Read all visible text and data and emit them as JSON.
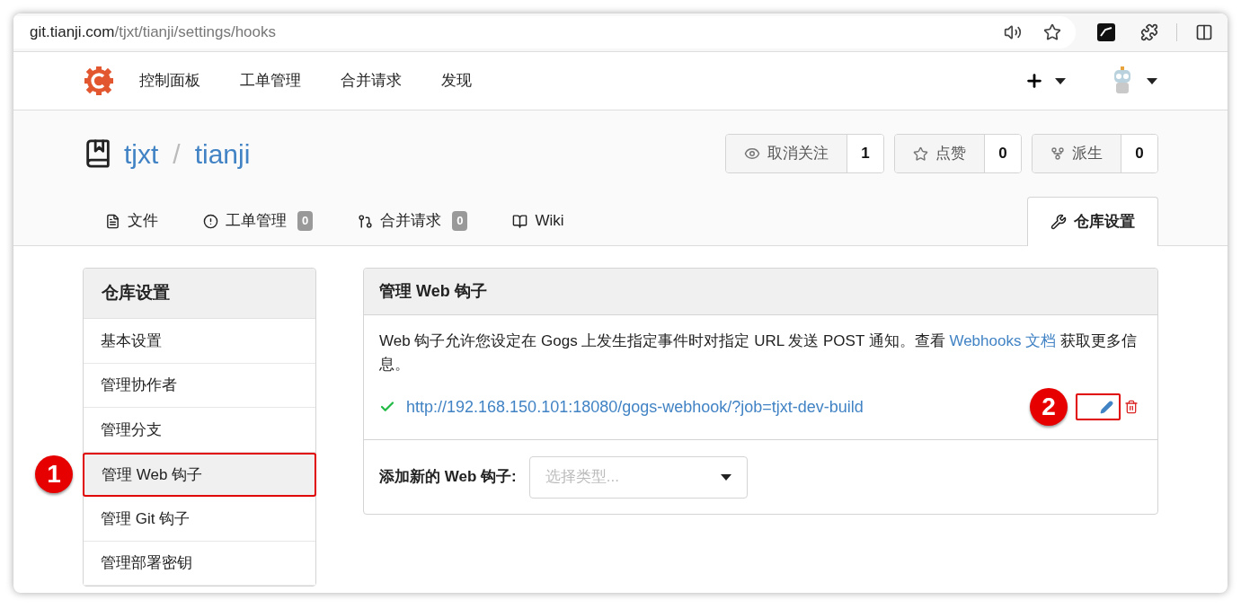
{
  "browser": {
    "url_host": "git.tianji.com",
    "url_path": "/tjxt/tianji/settings/hooks"
  },
  "nav": {
    "items": [
      "控制面板",
      "工单管理",
      "合并请求",
      "发现"
    ]
  },
  "repo": {
    "owner": "tjxt",
    "separator": "/",
    "name": "tianji"
  },
  "repo_buttons": [
    {
      "kind": "watch",
      "label": "取消关注",
      "count": "1"
    },
    {
      "kind": "star",
      "label": "点赞",
      "count": "0"
    },
    {
      "kind": "fork",
      "label": "派生",
      "count": "0"
    }
  ],
  "tabs": [
    {
      "kind": "files",
      "label": "文件",
      "selected": false
    },
    {
      "kind": "issues",
      "label": "工单管理",
      "count": "0",
      "selected": false
    },
    {
      "kind": "pulls",
      "label": "合并请求",
      "count": "0",
      "selected": false
    },
    {
      "kind": "wiki",
      "label": "Wiki",
      "selected": false
    },
    {
      "kind": "settings",
      "label": "仓库设置",
      "selected": true
    }
  ],
  "sidebar": {
    "title": "仓库设置",
    "items": [
      {
        "label": "基本设置",
        "selected": false,
        "highlighted": false
      },
      {
        "label": "管理协作者",
        "selected": false,
        "highlighted": false
      },
      {
        "label": "管理分支",
        "selected": false,
        "highlighted": false
      },
      {
        "label": "管理 Web 钩子",
        "selected": true,
        "highlighted": true,
        "callout": "1"
      },
      {
        "label": "管理 Git 钩子",
        "selected": false,
        "highlighted": false
      },
      {
        "label": "管理部署密钥",
        "selected": false,
        "highlighted": false
      }
    ]
  },
  "panel": {
    "title": "管理 Web 钩子",
    "description": {
      "before": "Web 钩子允许您设定在 Gogs 上发生指定事件时对指定 URL 发送 POST 通知。查看 ",
      "link": "Webhooks 文档",
      "after": " 获取更多信息。"
    },
    "hooks": [
      {
        "url": "http://192.168.150.101:18080/gogs-webhook/?job=tjxt-dev-build",
        "ok": true,
        "edit_highlighted": true,
        "callout": "2"
      }
    ],
    "add_label": "添加新的 Web 钩子:",
    "type_select": {
      "placeholder": "选择类型..."
    }
  }
}
